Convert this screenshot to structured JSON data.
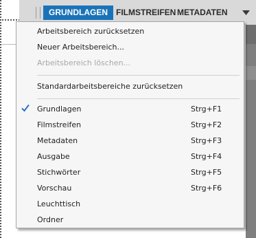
{
  "workspace_bar": {
    "tabs": [
      {
        "label": "GRUNDLAGEN",
        "active": true
      },
      {
        "label": "FILMSTREIFEN",
        "active": false
      },
      {
        "label": "METADATEN",
        "active": false
      }
    ],
    "dropdown_icon": "triangle-down-icon",
    "active_color": "#1a73b8"
  },
  "menu": {
    "actions": [
      {
        "label": "Arbeitsbereich zurücksetzen",
        "enabled": true
      },
      {
        "label": "Neuer Arbeitsbereich...",
        "enabled": true
      },
      {
        "label": "Arbeitsbereich löschen...",
        "enabled": false
      }
    ],
    "reset_defaults": {
      "label": "Standardarbeitsbereiche zurücksetzen"
    },
    "workspaces": [
      {
        "label": "Grundlagen",
        "shortcut": "Strg+F1",
        "checked": true
      },
      {
        "label": "Filmstreifen",
        "shortcut": "Strg+F2",
        "checked": false
      },
      {
        "label": "Metadaten",
        "shortcut": "Strg+F3",
        "checked": false
      },
      {
        "label": "Ausgabe",
        "shortcut": "Strg+F4",
        "checked": false
      },
      {
        "label": "Stichwörter",
        "shortcut": "Strg+F5",
        "checked": false
      },
      {
        "label": "Vorschau",
        "shortcut": "Strg+F6",
        "checked": false
      },
      {
        "label": "Leuchttisch",
        "shortcut": "",
        "checked": false
      },
      {
        "label": "Ordner",
        "shortcut": "",
        "checked": false
      }
    ],
    "check_icon": "checkmark-icon",
    "check_color": "#2a6fc9"
  }
}
